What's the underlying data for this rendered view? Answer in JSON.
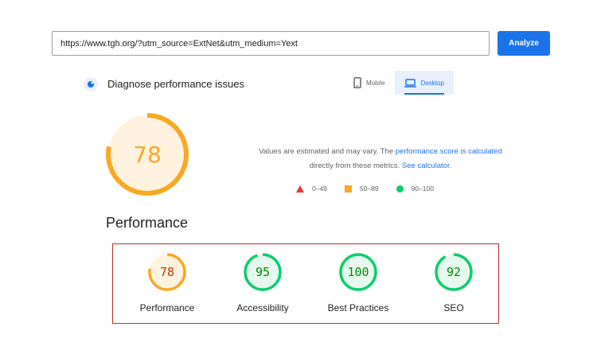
{
  "search": {
    "url_value": "https://www.tgh.org/?utm_source=ExtNet&utm_medium=Yext",
    "analyze_label": "Analyze"
  },
  "diagnose": {
    "title": "Diagnose performance issues",
    "icon": "lighthouse-icon"
  },
  "device_tabs": [
    {
      "label": "Mobile",
      "icon": "phone-icon",
      "active": false
    },
    {
      "label": "Desktop",
      "icon": "laptop-icon",
      "active": true
    }
  ],
  "main_score": {
    "value": "78",
    "score_fraction": 0.78,
    "color": "#f9a825"
  },
  "note": {
    "text_1": "Values are estimated and may vary. The ",
    "link_1": "performance score is calculated",
    "text_2": "directly from these metrics. ",
    "link_2": "See calculator."
  },
  "legend": [
    {
      "range": "0–49",
      "shape": "triangle",
      "color": "#e53935"
    },
    {
      "range": "50–89",
      "shape": "square",
      "color": "#f9a825"
    },
    {
      "range": "90–100",
      "shape": "circle",
      "color": "#0cce6b"
    }
  ],
  "performance_heading": "Performance",
  "category_scores": [
    {
      "label": "Performance",
      "value": "78",
      "score_fraction": 0.78,
      "color": "#f9a825",
      "text_color": "#c33300",
      "fill": "#fff3e0"
    },
    {
      "label": "Accessibility",
      "value": "95",
      "score_fraction": 0.95,
      "color": "#0cce6b",
      "text_color": "#008800",
      "fill": "#e6f9ee"
    },
    {
      "label": "Best Practices",
      "value": "100",
      "score_fraction": 1.0,
      "color": "#0cce6b",
      "text_color": "#008800",
      "fill": "#e6f9ee"
    },
    {
      "label": "SEO",
      "value": "92",
      "score_fraction": 0.92,
      "color": "#0cce6b",
      "text_color": "#008800",
      "fill": "#e6f9ee"
    }
  ]
}
